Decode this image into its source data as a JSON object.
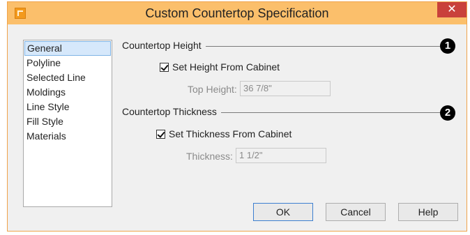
{
  "window": {
    "title": "Custom Countertop Specification",
    "close_glyph": "✕",
    "app_icon": "app-icon"
  },
  "nav": {
    "items": [
      "General",
      "Polyline",
      "Selected Line",
      "Moldings",
      "Line Style",
      "Fill Style",
      "Materials"
    ],
    "selected": "General"
  },
  "height_group": {
    "label": "Countertop Height",
    "badge": "1",
    "checkbox_label": "Set Height From Cabinet",
    "checkbox_checked": true,
    "field_label": "Top Height:",
    "field_value": "36 7/8\""
  },
  "thickness_group": {
    "label": "Countertop Thickness",
    "badge": "2",
    "checkbox_label": "Set Thickness From Cabinet",
    "checkbox_checked": true,
    "field_label": "Thickness:",
    "field_value": "1 1/2\""
  },
  "buttons": {
    "ok": "OK",
    "cancel": "Cancel",
    "help": "Help"
  },
  "colors": {
    "titlebar": "#fbbf6b",
    "close": "#c9413b",
    "selection": "#d6e8fb",
    "default_border": "#3c7fd0"
  }
}
